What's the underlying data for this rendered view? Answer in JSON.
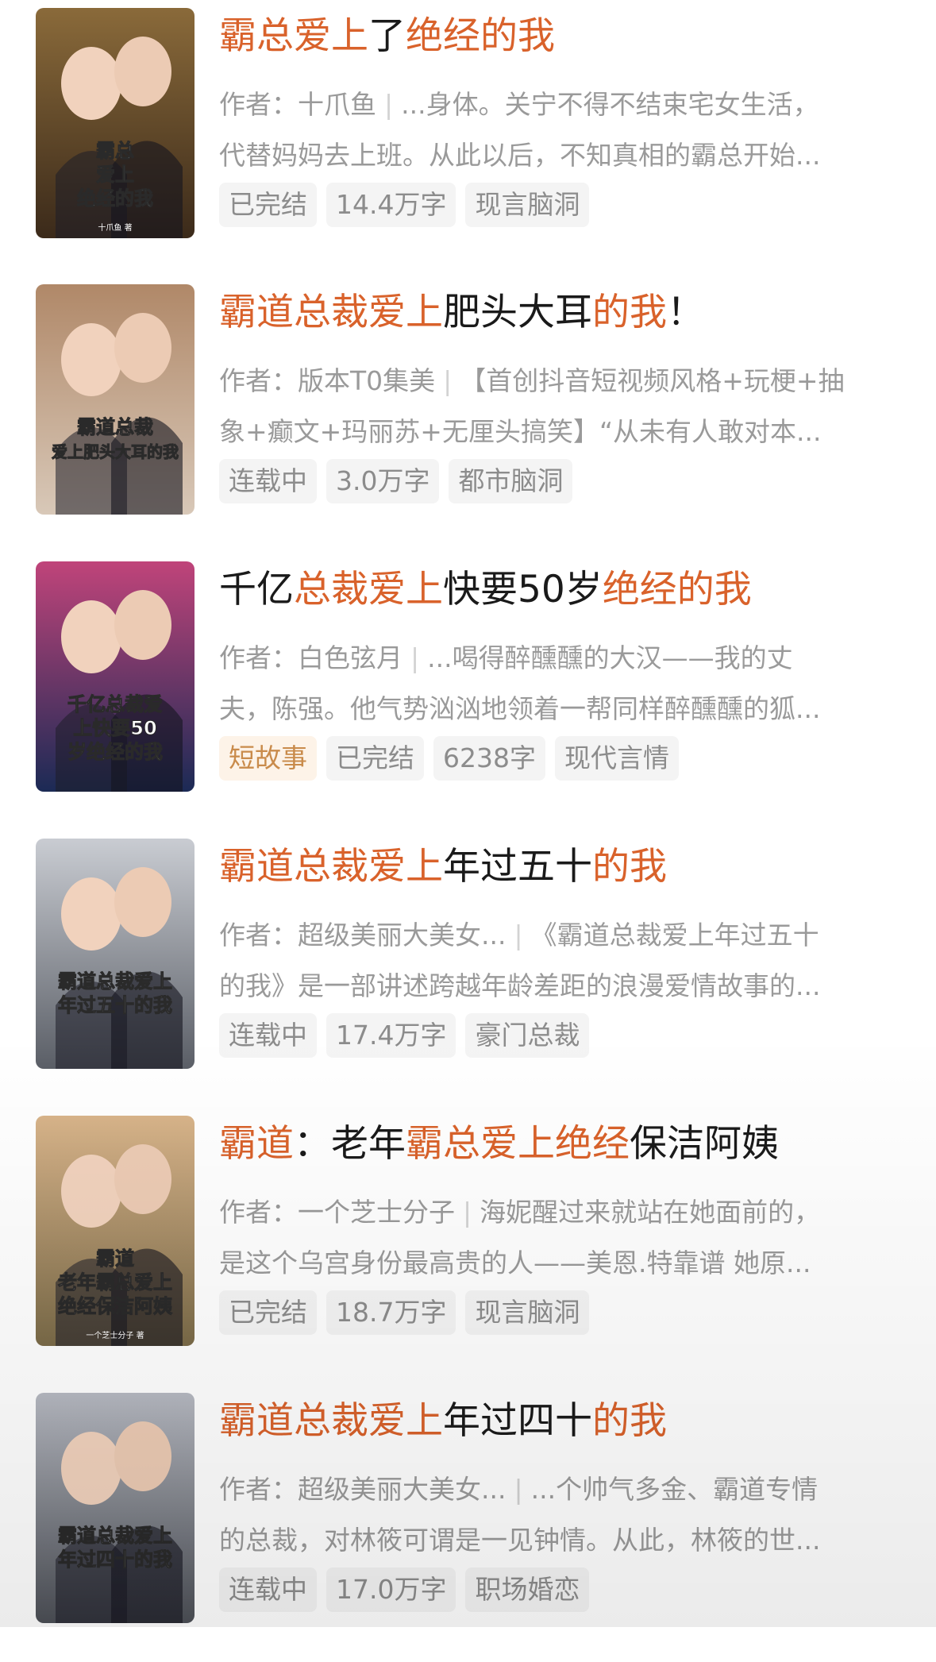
{
  "colors": {
    "highlight": "#d9622b",
    "title": "#1a1a1a",
    "meta": "#9a9a9a",
    "tag_bg": "#f4f4f4",
    "tag_accent_bg": "#fdf3e8",
    "tag_accent_text": "#c98b4b"
  },
  "books": [
    {
      "title_parts": [
        {
          "t": "霸总爱上",
          "hl": true
        },
        {
          "t": "了",
          "hl": false
        },
        {
          "t": "绝经的我",
          "hl": true
        }
      ],
      "author": "作者：十爪鱼",
      "desc_line1": "...身体。关宁不得不结束宅女生活，",
      "desc_line2": "代替妈妈去上班。从此以后，不知真相的霸总开始...",
      "tags": [
        {
          "t": "已完结",
          "accent": false
        },
        {
          "t": "14.4万字",
          "accent": false
        },
        {
          "t": "现言脑洞",
          "accent": false
        }
      ],
      "cover": {
        "text1": "霸总",
        "text2": "爱上",
        "text3": "绝经的我",
        "author": "十爪鱼 著",
        "icon": "couple-kiss-cover",
        "bg1": "#3b2a1a",
        "bg2": "#8a6a3a"
      }
    },
    {
      "title_parts": [
        {
          "t": "霸道总裁爱上",
          "hl": true
        },
        {
          "t": "肥头大耳",
          "hl": false
        },
        {
          "t": "的我",
          "hl": true
        },
        {
          "t": "！",
          "hl": false
        }
      ],
      "author": "作者：版本T0集美",
      "desc_line1": "【首创抖音短视频风格+玩梗+抽",
      "desc_line2": "象+癫文+玛丽苏+无厘头搞笑】“从未有人敢对本...",
      "tags": [
        {
          "t": "连载中",
          "accent": false
        },
        {
          "t": "3.0万字",
          "accent": false
        },
        {
          "t": "都市脑洞",
          "accent": false
        }
      ],
      "cover": {
        "text1": "霸道总裁",
        "text2": "爱上肥头大耳的我",
        "text3": "",
        "author": "",
        "icon": "couple-cartoon-cover",
        "bg1": "#d8c8b8",
        "bg2": "#b08868"
      }
    },
    {
      "title_parts": [
        {
          "t": "千亿",
          "hl": false
        },
        {
          "t": "总裁爱上",
          "hl": true
        },
        {
          "t": "快要50岁",
          "hl": false
        },
        {
          "t": "绝经的我",
          "hl": true
        }
      ],
      "author": "作者：白色弦月",
      "desc_line1": "...喝得醉醺醺的大汉——我的丈",
      "desc_line2": "夫，陈强。他气势汹汹地领着一帮同样醉醺醺的狐...",
      "tags": [
        {
          "t": "短故事",
          "accent": true
        },
        {
          "t": "已完结",
          "accent": false
        },
        {
          "t": "6238字",
          "accent": false
        },
        {
          "t": "现代言情",
          "accent": false
        }
      ],
      "cover": {
        "text1": "千亿总裁爱",
        "text2": "上快要50",
        "text3": "岁绝经的我",
        "author": "",
        "icon": "city-woman-cover",
        "bg1": "#1b2a55",
        "bg2": "#c0447a"
      }
    },
    {
      "title_parts": [
        {
          "t": "霸道总裁爱上",
          "hl": true
        },
        {
          "t": "年过五十",
          "hl": false
        },
        {
          "t": "的我",
          "hl": true
        }
      ],
      "author": "作者：超级美丽大美女...",
      "desc_line1": "《霸道总裁爱上年过五十",
      "desc_line2": "的我》是一部讲述跨越年龄差距的浪漫爱情故事的...",
      "tags": [
        {
          "t": "连载中",
          "accent": false
        },
        {
          "t": "17.4万字",
          "accent": false
        },
        {
          "t": "豪门总裁",
          "accent": false
        }
      ],
      "cover": {
        "text1": "霸道总裁爱上",
        "text2": "年过五十的我",
        "text3": "",
        "author": "",
        "icon": "silver-couple-cover",
        "bg1": "#5a5e66",
        "bg2": "#c9ccd2"
      }
    },
    {
      "title_parts": [
        {
          "t": "霸道",
          "hl": true
        },
        {
          "t": "：老年",
          "hl": false
        },
        {
          "t": "霸总爱上绝经",
          "hl": true
        },
        {
          "t": "保洁阿姨",
          "hl": false
        }
      ],
      "author": "作者：一个芝士分子",
      "desc_line1": "海妮醒过来就站在她面前的，",
      "desc_line2": "是这个乌宫身份最高贵的人——美恩.特靠谱 她原...",
      "tags": [
        {
          "t": "已完结",
          "accent": false
        },
        {
          "t": "18.7万字",
          "accent": false
        },
        {
          "t": "现言脑洞",
          "accent": false
        }
      ],
      "cover": {
        "text1": "霸道",
        "text2": "老年霸总爱上",
        "text3": "绝经保洁阿姨",
        "author": "一个芝士分子 著",
        "icon": "blond-couple-cover",
        "bg1": "#7a6a48",
        "bg2": "#d8b48a"
      }
    },
    {
      "title_parts": [
        {
          "t": "霸道总裁爱上",
          "hl": true
        },
        {
          "t": "年过四十",
          "hl": false
        },
        {
          "t": "的我",
          "hl": true
        }
      ],
      "author": "作者：超级美丽大美女...",
      "desc_line1": "...个帅气多金、霸道专情",
      "desc_line2": "的总裁，对林筱可谓是一见钟情。从此，林筱的世...",
      "tags": [
        {
          "t": "连载中",
          "accent": false
        },
        {
          "t": "17.0万字",
          "accent": false
        },
        {
          "t": "职场婚恋",
          "accent": false
        }
      ],
      "cover": {
        "text1": "霸道总裁爱上",
        "text2": "年过四十的我",
        "text3": "",
        "author": "",
        "icon": "silver-couple-cover-2",
        "bg1": "#4c4f56",
        "bg2": "#b7bac2"
      }
    }
  ]
}
